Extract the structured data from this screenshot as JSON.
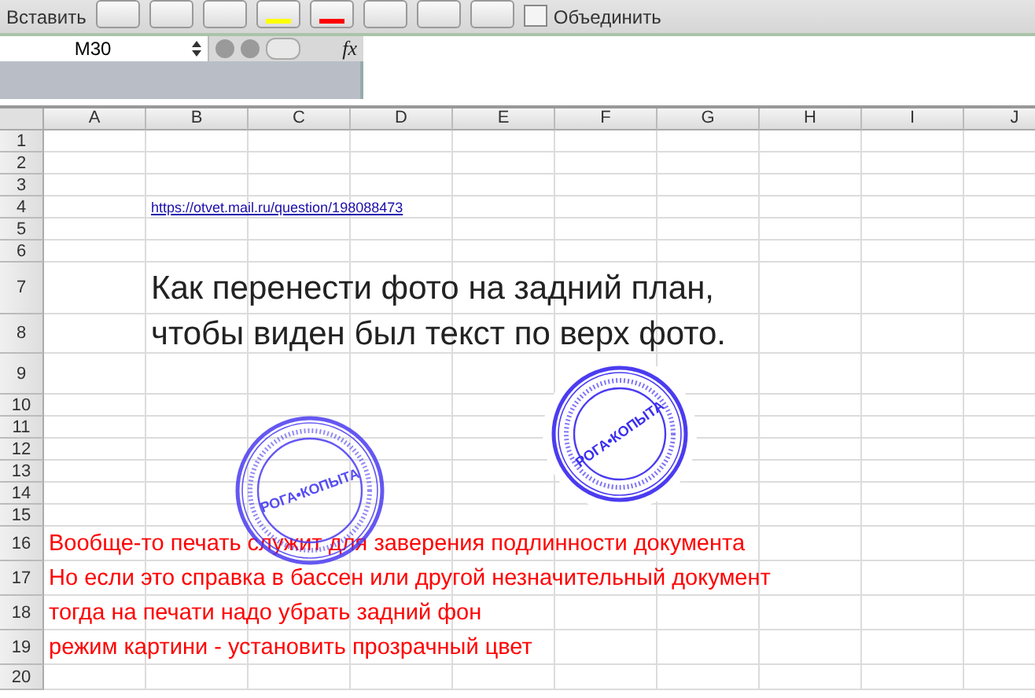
{
  "ribbon": {
    "paste_label": "Вставить",
    "merge_label": "Объединить",
    "merge_checked": false
  },
  "formula_bar": {
    "name_box": "M30",
    "fx_label": "fx"
  },
  "sheet": {
    "columns": [
      "A",
      "B",
      "C",
      "D",
      "E",
      "F",
      "G",
      "H",
      "I",
      "J"
    ],
    "rows": [
      {
        "number": "1"
      },
      {
        "number": "2"
      },
      {
        "number": "3"
      },
      {
        "number": "4",
        "kind": "link",
        "text": "https://otvet.mail.ru/question/198088473"
      },
      {
        "number": "5"
      },
      {
        "number": "6"
      },
      {
        "number": "7",
        "kind": "heading",
        "text": "Как перенести фото на задний план,"
      },
      {
        "number": "8",
        "kind": "heading",
        "text": "чтобы виден был текст по верх фото."
      },
      {
        "number": "9"
      },
      {
        "number": "10"
      },
      {
        "number": "11"
      },
      {
        "number": "12"
      },
      {
        "number": "13"
      },
      {
        "number": "14"
      },
      {
        "number": "15"
      },
      {
        "number": "16",
        "kind": "note",
        "text": "Вообще-то печать служит для заверения подлинности документа"
      },
      {
        "number": "17",
        "kind": "note",
        "text": "Но если это справка в бассен или другой незначительный документ"
      },
      {
        "number": "18",
        "kind": "note",
        "text": "тогда на печати надо убрать задний фон"
      },
      {
        "number": "19",
        "kind": "note",
        "text": "режим картини - установить прозрачный цвет"
      },
      {
        "number": "20"
      }
    ]
  },
  "stamps": [
    {
      "label": "РОГА•КОПЫТА",
      "kind": "opaque"
    },
    {
      "label": "РОГА•КОПЫТА",
      "kind": "transparent"
    }
  ]
}
